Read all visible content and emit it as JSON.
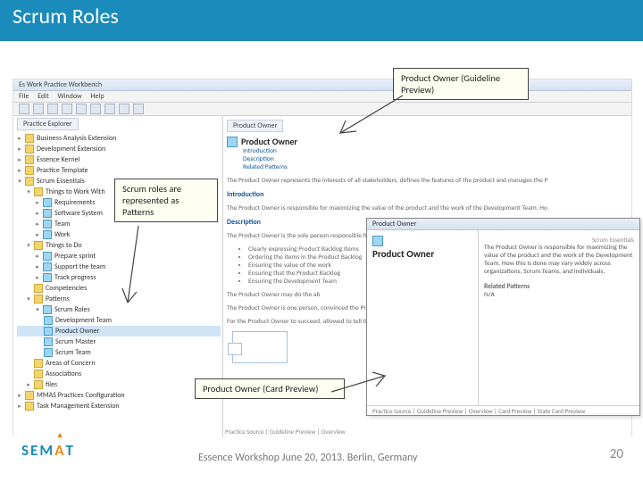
{
  "slide": {
    "title": "Scrum Roles",
    "footer": "Essence Workshop June 20, 2013. Berlin, Germany",
    "page_number": "20",
    "logo_text": {
      "s": "S",
      "e": "E",
      "m": "M",
      "a": "A",
      "t": "T"
    }
  },
  "callouts": {
    "patterns": "Scrum roles are represented as Patterns",
    "guideline": "Product Owner (Guideline Preview)",
    "card": "Product Owner (Card Preview)"
  },
  "workbench": {
    "window_title": "Es Work Practice Workbench",
    "menu": {
      "file": "File",
      "edit": "Edit",
      "window": "Window",
      "help": "Help"
    },
    "explorer_tab": "Practice Explorer",
    "tree": {
      "ext_ba": "Business Analysis Extension",
      "ext_dev": "Development Extension",
      "kernel": "Essence Kernel",
      "template": "Practice Template",
      "scrum": "Scrum Essentials",
      "things_to_work": "Things to Work With",
      "alpha_req": "Requirements",
      "alpha_sys": "Software System",
      "alpha_team": "Team",
      "alpha_work": "Work",
      "things_to_do": "Things to Do",
      "act_prepare": "Prepare sprint",
      "act_support": "Support the team",
      "act_track": "Track progress",
      "competencies": "Competencies",
      "patterns": "Patterns",
      "scrum_roles": "Scrum Roles",
      "dev_team": "Development Team",
      "product_owner": "Product Owner",
      "scrum_master": "Scrum Master",
      "scrum_team": "Scrum Team",
      "areas": "Areas of Concern",
      "assoc": "Associations",
      "files": "files",
      "mmas_cfg": "MMAS Practices Configuration",
      "task_ext": "Task Management Extension"
    }
  },
  "guideline": {
    "tab": "Product Owner",
    "heading": "Product Owner",
    "link_intro": "Introduction",
    "link_desc": "Description",
    "link_rel": "Related Patterns",
    "para_top": "The Product Owner represents the interests of all stakeholders, defines the features of the product and manages the P",
    "h_intro": "Introduction",
    "para_intro": "The Product Owner is responsible for maximizing the value of the product and the work of the Development Team. Ho",
    "h_desc": "Description",
    "para_desc": "The Product Owner is the sole person responsible for managing the Product Backlog. Product Backlog management in",
    "b1": "Clearly expressing Product Backlog items",
    "b2": "Ordering the items in the Product Backlog",
    "b3": "Ensuring the value of the work",
    "b4": "Ensuring that the Product Backlog",
    "b5": "Ensuring the Development Team",
    "para_may": "The Product Owner may do the ab",
    "para_org": "The Product Owner is one person, convinced the Product Owner",
    "para_succ": "For the Product Owner to succeed, allowed to tell the Development T",
    "footer_tabs": "Practice Source | Guideline Preview | Overview"
  },
  "card": {
    "title_bar": "Product Owner",
    "right_tab": "Scrum Essentials",
    "heading": "Product Owner",
    "body": "The Product Owner is responsible for maximizing the value of the product and the work of the Development Team. How this is done may vary widely across organizations, Scrum Teams, and individuals.",
    "rel_h": "Related Patterns",
    "rel_v": "N/A",
    "footer_tabs": "Practice Source | Guideline Preview | Overview | Card Preview | State Card Preview"
  }
}
